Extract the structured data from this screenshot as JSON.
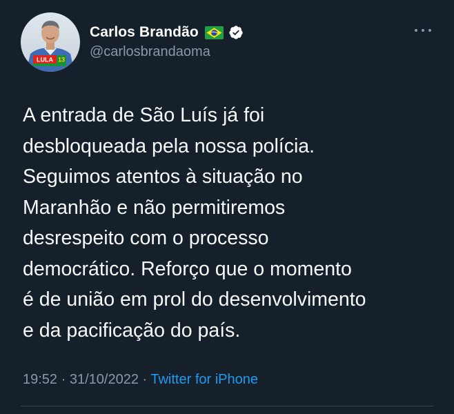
{
  "tweet": {
    "author": {
      "display_name": "Carlos Brandão",
      "handle": "@carlosbrandaoma",
      "flag_icon": "brazil-flag-icon",
      "verified_icon": "verified-badge-icon",
      "avatar_badge_text": "LULA",
      "avatar_badge_number": "13"
    },
    "text": "A entrada de São Luís já foi\ndesbloqueada pela nossa polícia.\nSeguimos atentos à situação no\nMaranhão e não permitiremos\ndesrespeito com o processo\ndemocrático. Reforço que o momento\né de união em prol do desenvolvimento\ne da pacificação do país.",
    "meta": {
      "time": "19:52",
      "separator": " · ",
      "date": "31/10/2022",
      "source": "Twitter for iPhone"
    },
    "more_icon": "more-options-icon"
  },
  "colors": {
    "background": "#15202b",
    "text": "#f7f9f9",
    "muted": "#8b98a5",
    "link": "#1d9bf0",
    "verified": "#ffffff"
  }
}
